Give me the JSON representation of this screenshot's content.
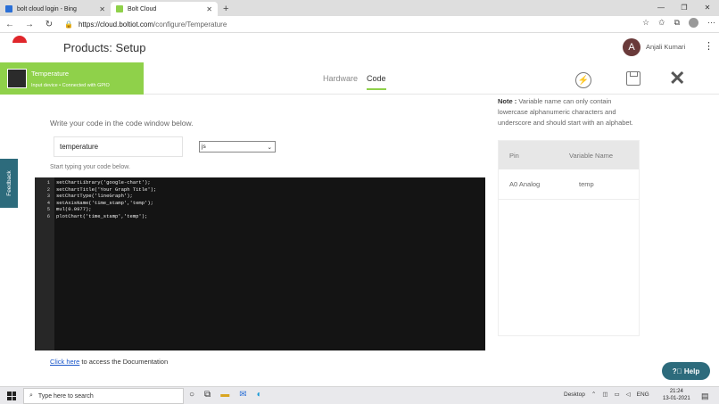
{
  "browser": {
    "tabs": [
      {
        "title": "bolt cloud login - Bing",
        "favicon_color": "#2a6fd6"
      },
      {
        "title": "Bolt Cloud",
        "favicon_color": "#8fd14a"
      }
    ],
    "url_host": "https://cloud.boltiot.com",
    "url_path": "/configure/Temperature"
  },
  "header": {
    "title": "Products: Setup",
    "user_initial": "A",
    "user_name": "Anjali Kumari"
  },
  "device": {
    "name": "Temperature",
    "subtitle": "Input device • Connected with GPIO"
  },
  "tabs": {
    "hardware": "Hardware",
    "code": "Code"
  },
  "editor": {
    "instruction": "Write your code in the code window below.",
    "variable_value": "temperature",
    "language": "js",
    "start_hint": "Start typing your code below.",
    "doc_link_text": "Click here",
    "doc_suffix": " to access the Documentation"
  },
  "code_lines": [
    "setChartLibrary('google-chart');",
    "setChartTitle('Your Graph Title');",
    "setChartType('lineGraph');",
    "setAxisName('time_stamp','temp');",
    "mul(0.0977);",
    "plotChart('time_stamp','temp');"
  ],
  "note": {
    "label": "Note :",
    "text": " Variable name can only contain lowercase alphanumeric characters and underscore and should start with an alphabet."
  },
  "variable_table": {
    "headers": [
      "Pin",
      "Variable Name"
    ],
    "rows": [
      [
        "A0 Analog",
        "temp"
      ]
    ]
  },
  "feedback_label": "Feedback",
  "help_label": "Help",
  "taskbar": {
    "search_placeholder": "Type here to search",
    "desktop_label": "Desktop",
    "lang": "ENG",
    "time": "21:24",
    "date": "13-01-2021"
  }
}
